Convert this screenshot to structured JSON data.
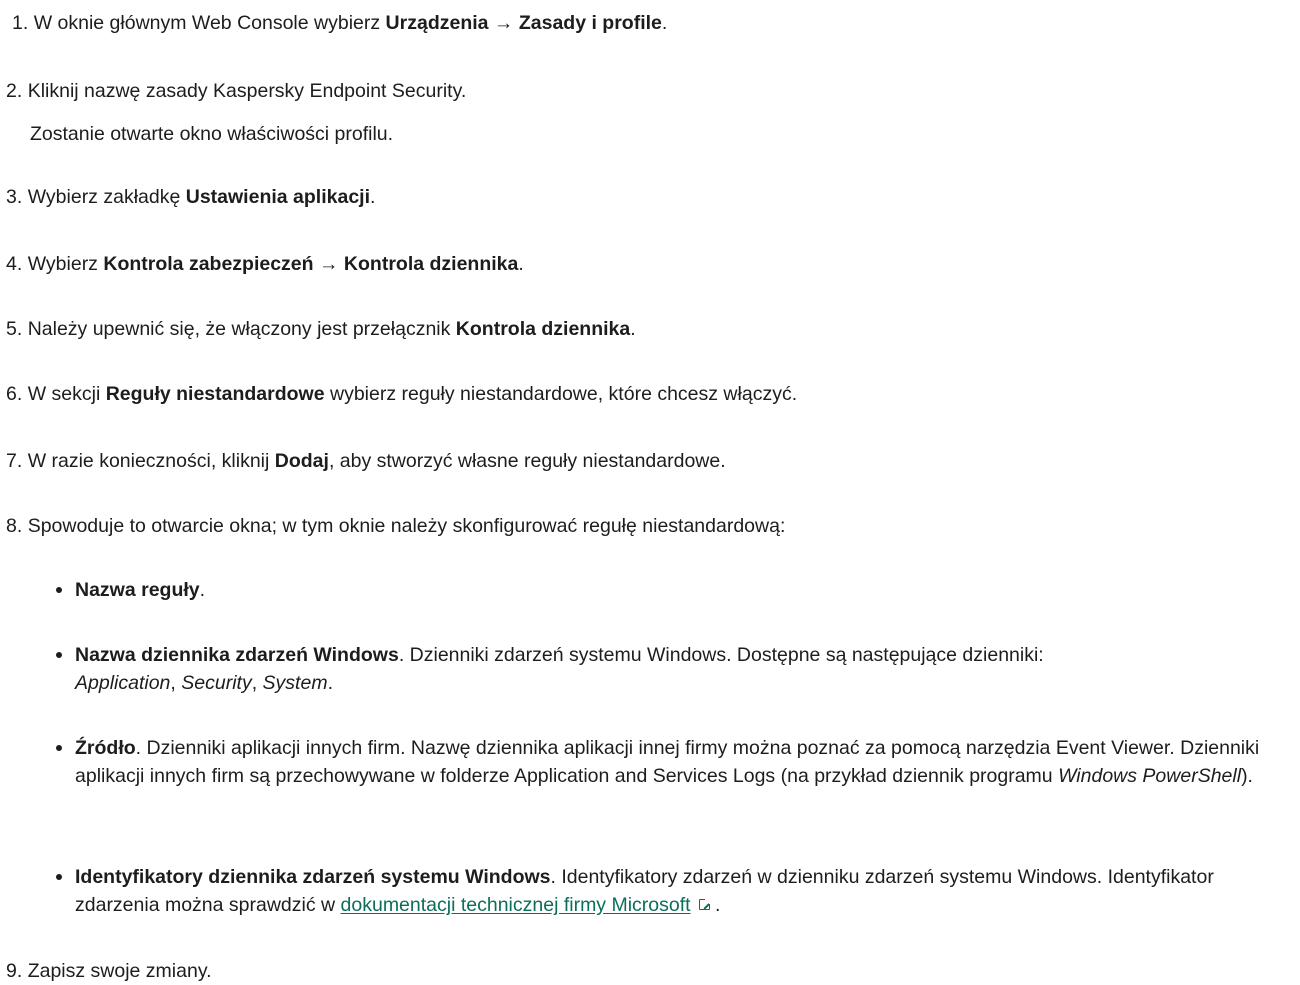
{
  "steps": [
    {
      "num": "1.",
      "parts": [
        "W oknie głównym Web Console wybierz ",
        "Urządzenia",
        " → ",
        "Zasady i profile",
        "."
      ]
    },
    {
      "num": "2.",
      "text": "Kliknij nazwę zasady Kaspersky Endpoint Security.",
      "note": "Zostanie otwarte okno właściwości profilu."
    },
    {
      "num": "3.",
      "parts": [
        "Wybierz zakładkę ",
        "Ustawienia aplikacji",
        "."
      ]
    },
    {
      "num": "4.",
      "parts": [
        "Wybierz ",
        "Kontrola zabezpieczeń",
        " → ",
        "Kontrola dziennika",
        "."
      ]
    },
    {
      "num": "5.",
      "parts": [
        "Należy upewnić się, że włączony jest przełącznik ",
        "Kontrola dziennika",
        "."
      ]
    },
    {
      "num": "6.",
      "parts": [
        "W sekcji ",
        "Reguły niestandardowe",
        " wybierz reguły niestandardowe, które chcesz włączyć."
      ]
    },
    {
      "num": "7.",
      "parts": [
        "W razie konieczności, kliknij ",
        "Dodaj",
        ", aby stworzyć własne reguły niestandardowe."
      ]
    },
    {
      "num": "8.",
      "text": "Spowoduje to otwarcie okna; w tym oknie należy skonfigurować regułę niestandardową:"
    },
    {
      "num": "9.",
      "text": "Zapisz swoje zmiany."
    }
  ],
  "bullets": [
    {
      "term": "Nazwa reguły",
      "rest": "."
    },
    {
      "term": "Nazwa dziennika zdarzeń Windows",
      "rest": ". Dzienniki zdarzeń systemu Windows. Dostępne są następujące dzienniki:",
      "italics": [
        "Application",
        "Security",
        "System"
      ],
      "sep": ", ",
      "end": "."
    },
    {
      "term": "Źródło",
      "rest_a": ". Dzienniki aplikacji innych firm. Nazwę dziennika aplikacji innej firmy można poznać za pomocą narzędzia Event Viewer. Dzienniki aplikacji innych firm są przechowywane w folderze Application and Services Logs (na przykład dziennik programu ",
      "italic": "Windows PowerShell",
      "rest_b": ")."
    },
    {
      "term": "Identyfikatory dziennika zdarzeń systemu Windows",
      "rest": ". Identyfikatory zdarzeń w dzienniku zdarzeń systemu Windows. Identyfikator zdarzenia można sprawdzić w ",
      "link": "dokumentacji technicznej firmy Microsoft",
      "end": " ."
    }
  ]
}
